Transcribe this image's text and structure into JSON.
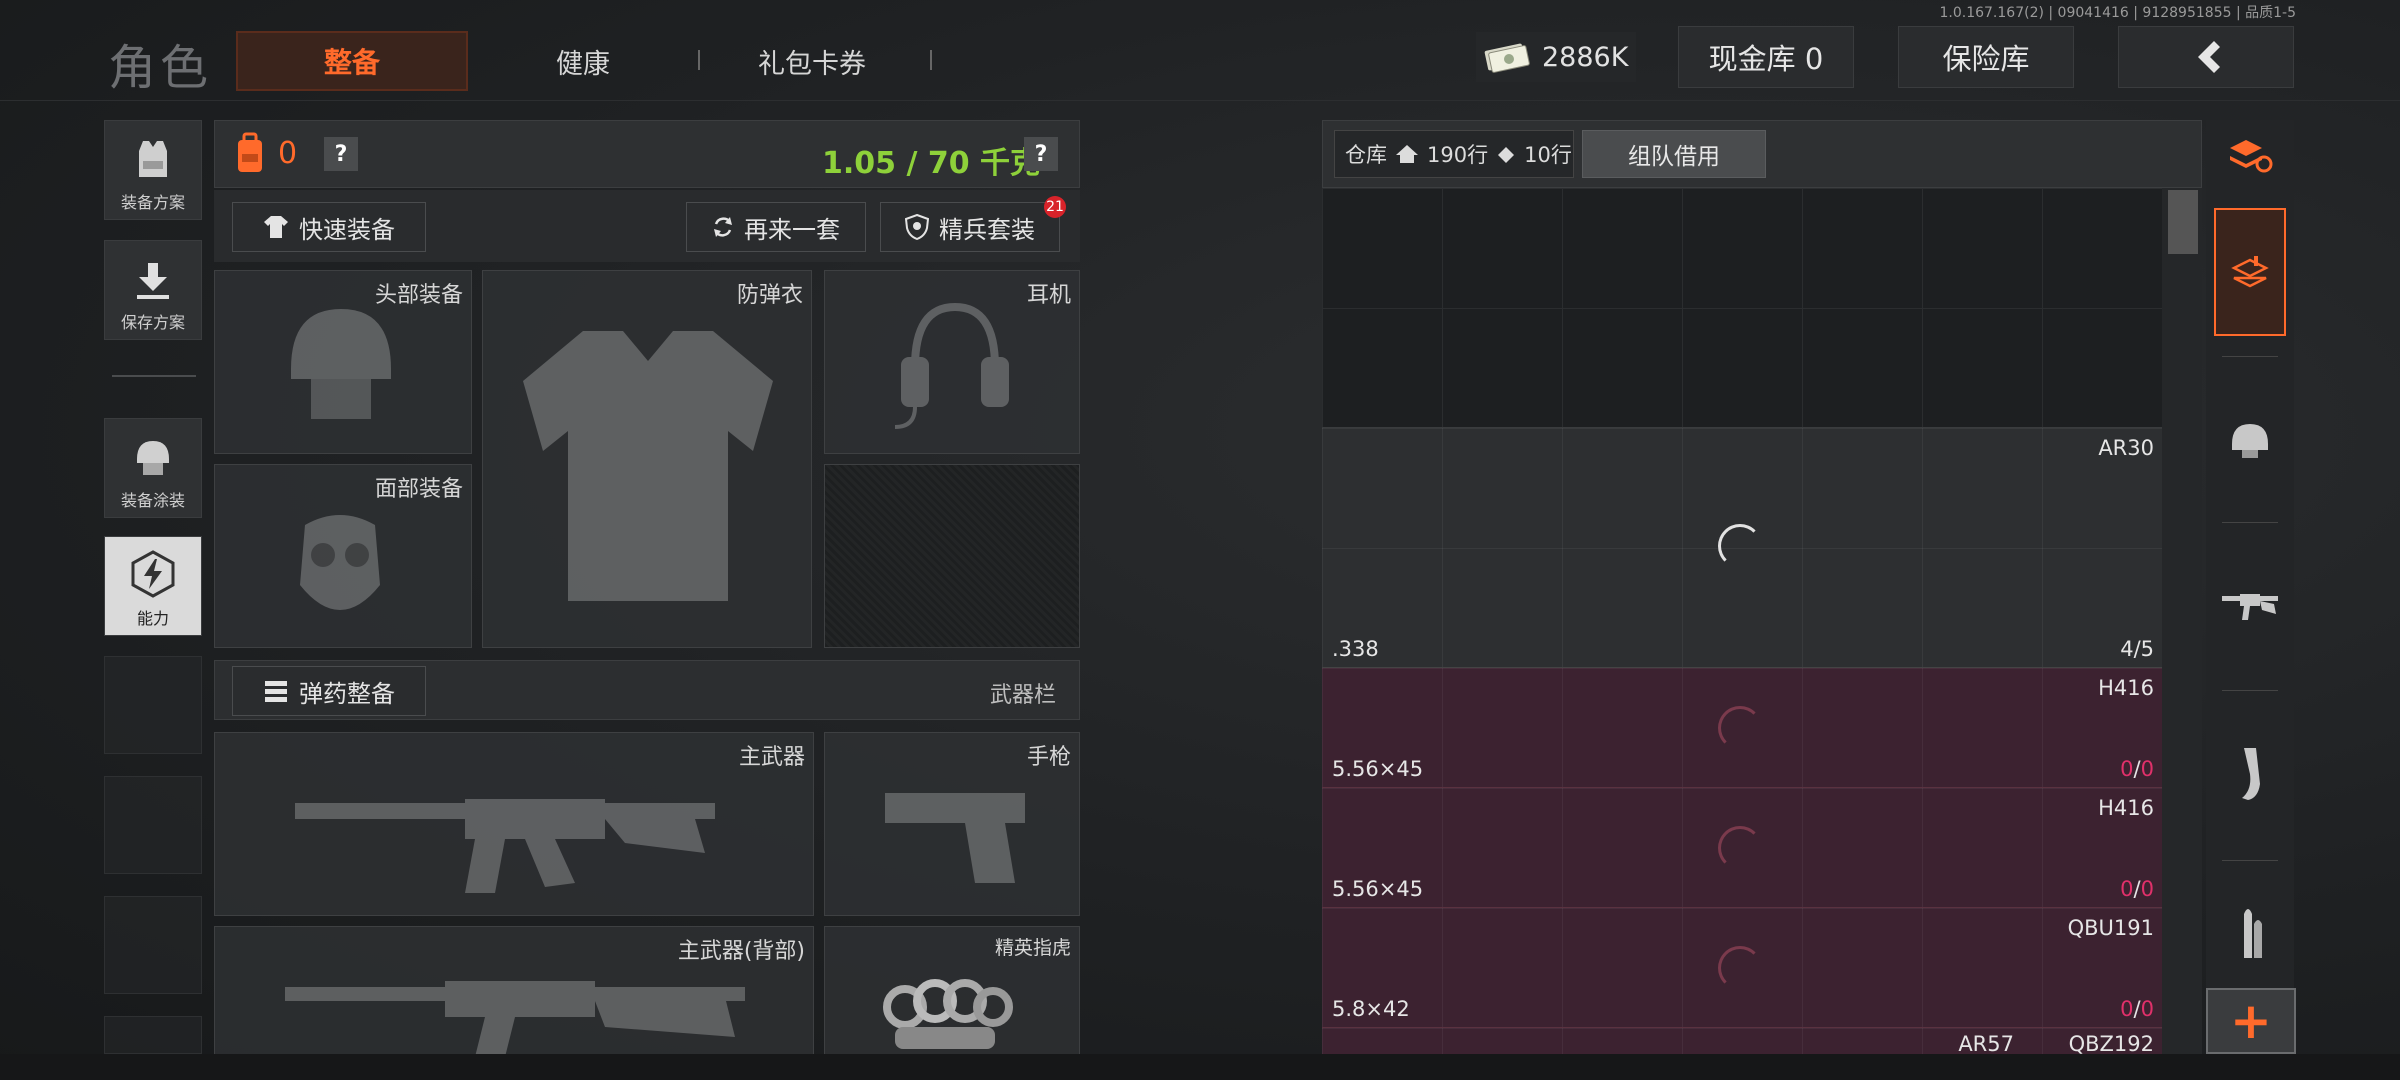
{
  "version": "1.0.167.167(2) | 09041416 | 9128951855 | 品质1-5",
  "header": {
    "title": "角色",
    "tabs": [
      {
        "label": "整备",
        "active": true
      },
      {
        "label": "健康"
      },
      {
        "label": "礼包卡券"
      }
    ],
    "money": "2886K",
    "cash_vault": "现金库 0",
    "safe_box": "保险库",
    "accent": "#ff6a2b"
  },
  "sidebar": {
    "items": [
      {
        "label": "装备方案",
        "icon": "vest-icon"
      },
      {
        "label": "保存方案",
        "icon": "download-icon"
      },
      {
        "label": "装备涂装",
        "icon": "helmet-icon"
      },
      {
        "label": "能力",
        "icon": "lightning-icon",
        "active": true
      }
    ]
  },
  "equipment": {
    "bag_count": "0",
    "help": "?",
    "weight": "1.05 / 70 千克",
    "quick_equip": "快速装备",
    "repeat": "再来一套",
    "elite_set": "精兵套装",
    "elite_badge": "21",
    "slots": {
      "head": "头部装备",
      "armor": "防弹衣",
      "headset": "耳机",
      "face": "面部装备"
    },
    "ammo_equip": "弹药整备",
    "weapon_bar": "武器栏",
    "weapons": {
      "primary": "主武器",
      "pistol": "手枪",
      "primary_back": "主武器(背部)",
      "melee": "精英指虎"
    }
  },
  "warehouse": {
    "label": "仓库",
    "rows": "190行",
    "tickets": "10行",
    "team_borrow": "组队借用",
    "items": [
      {
        "name": "AR30",
        "caliber": ".338",
        "count": "4/5",
        "style": "gray"
      },
      {
        "name": "H416",
        "caliber": "5.56×45",
        "count_a": "0",
        "count_b": "0",
        "style": "red"
      },
      {
        "name": "H416",
        "caliber": "5.56×45",
        "count_a": "0",
        "count_b": "0",
        "style": "red"
      },
      {
        "name": "QBU191",
        "caliber": "5.8×42",
        "count_a": "0",
        "count_b": "0",
        "style": "red"
      },
      {
        "name": "AR57",
        "name2": "QBZ192",
        "style": "red"
      }
    ]
  },
  "rail": {
    "plus": "+"
  }
}
